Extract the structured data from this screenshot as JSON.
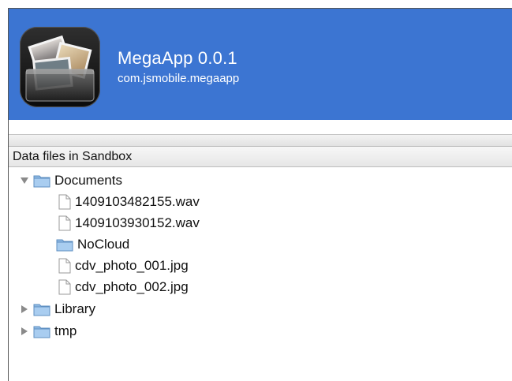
{
  "app": {
    "name": "MegaApp 0.0.1",
    "bundle_id": "com.jsmobile.megaapp",
    "icon": "photo-stack-icon",
    "header_color": "#3c75d2"
  },
  "sandbox": {
    "header": "Data files in Sandbox",
    "tree": {
      "documents": {
        "label": "Documents",
        "expanded": true,
        "children": {
          "wav1": "1409103482155.wav",
          "wav2": "1409103930152.wav",
          "nocloud": "NoCloud",
          "photo1": "cdv_photo_001.jpg",
          "photo2": "cdv_photo_002.jpg"
        }
      },
      "library": {
        "label": "Library",
        "expanded": false
      },
      "tmp": {
        "label": "tmp",
        "expanded": false
      }
    }
  }
}
